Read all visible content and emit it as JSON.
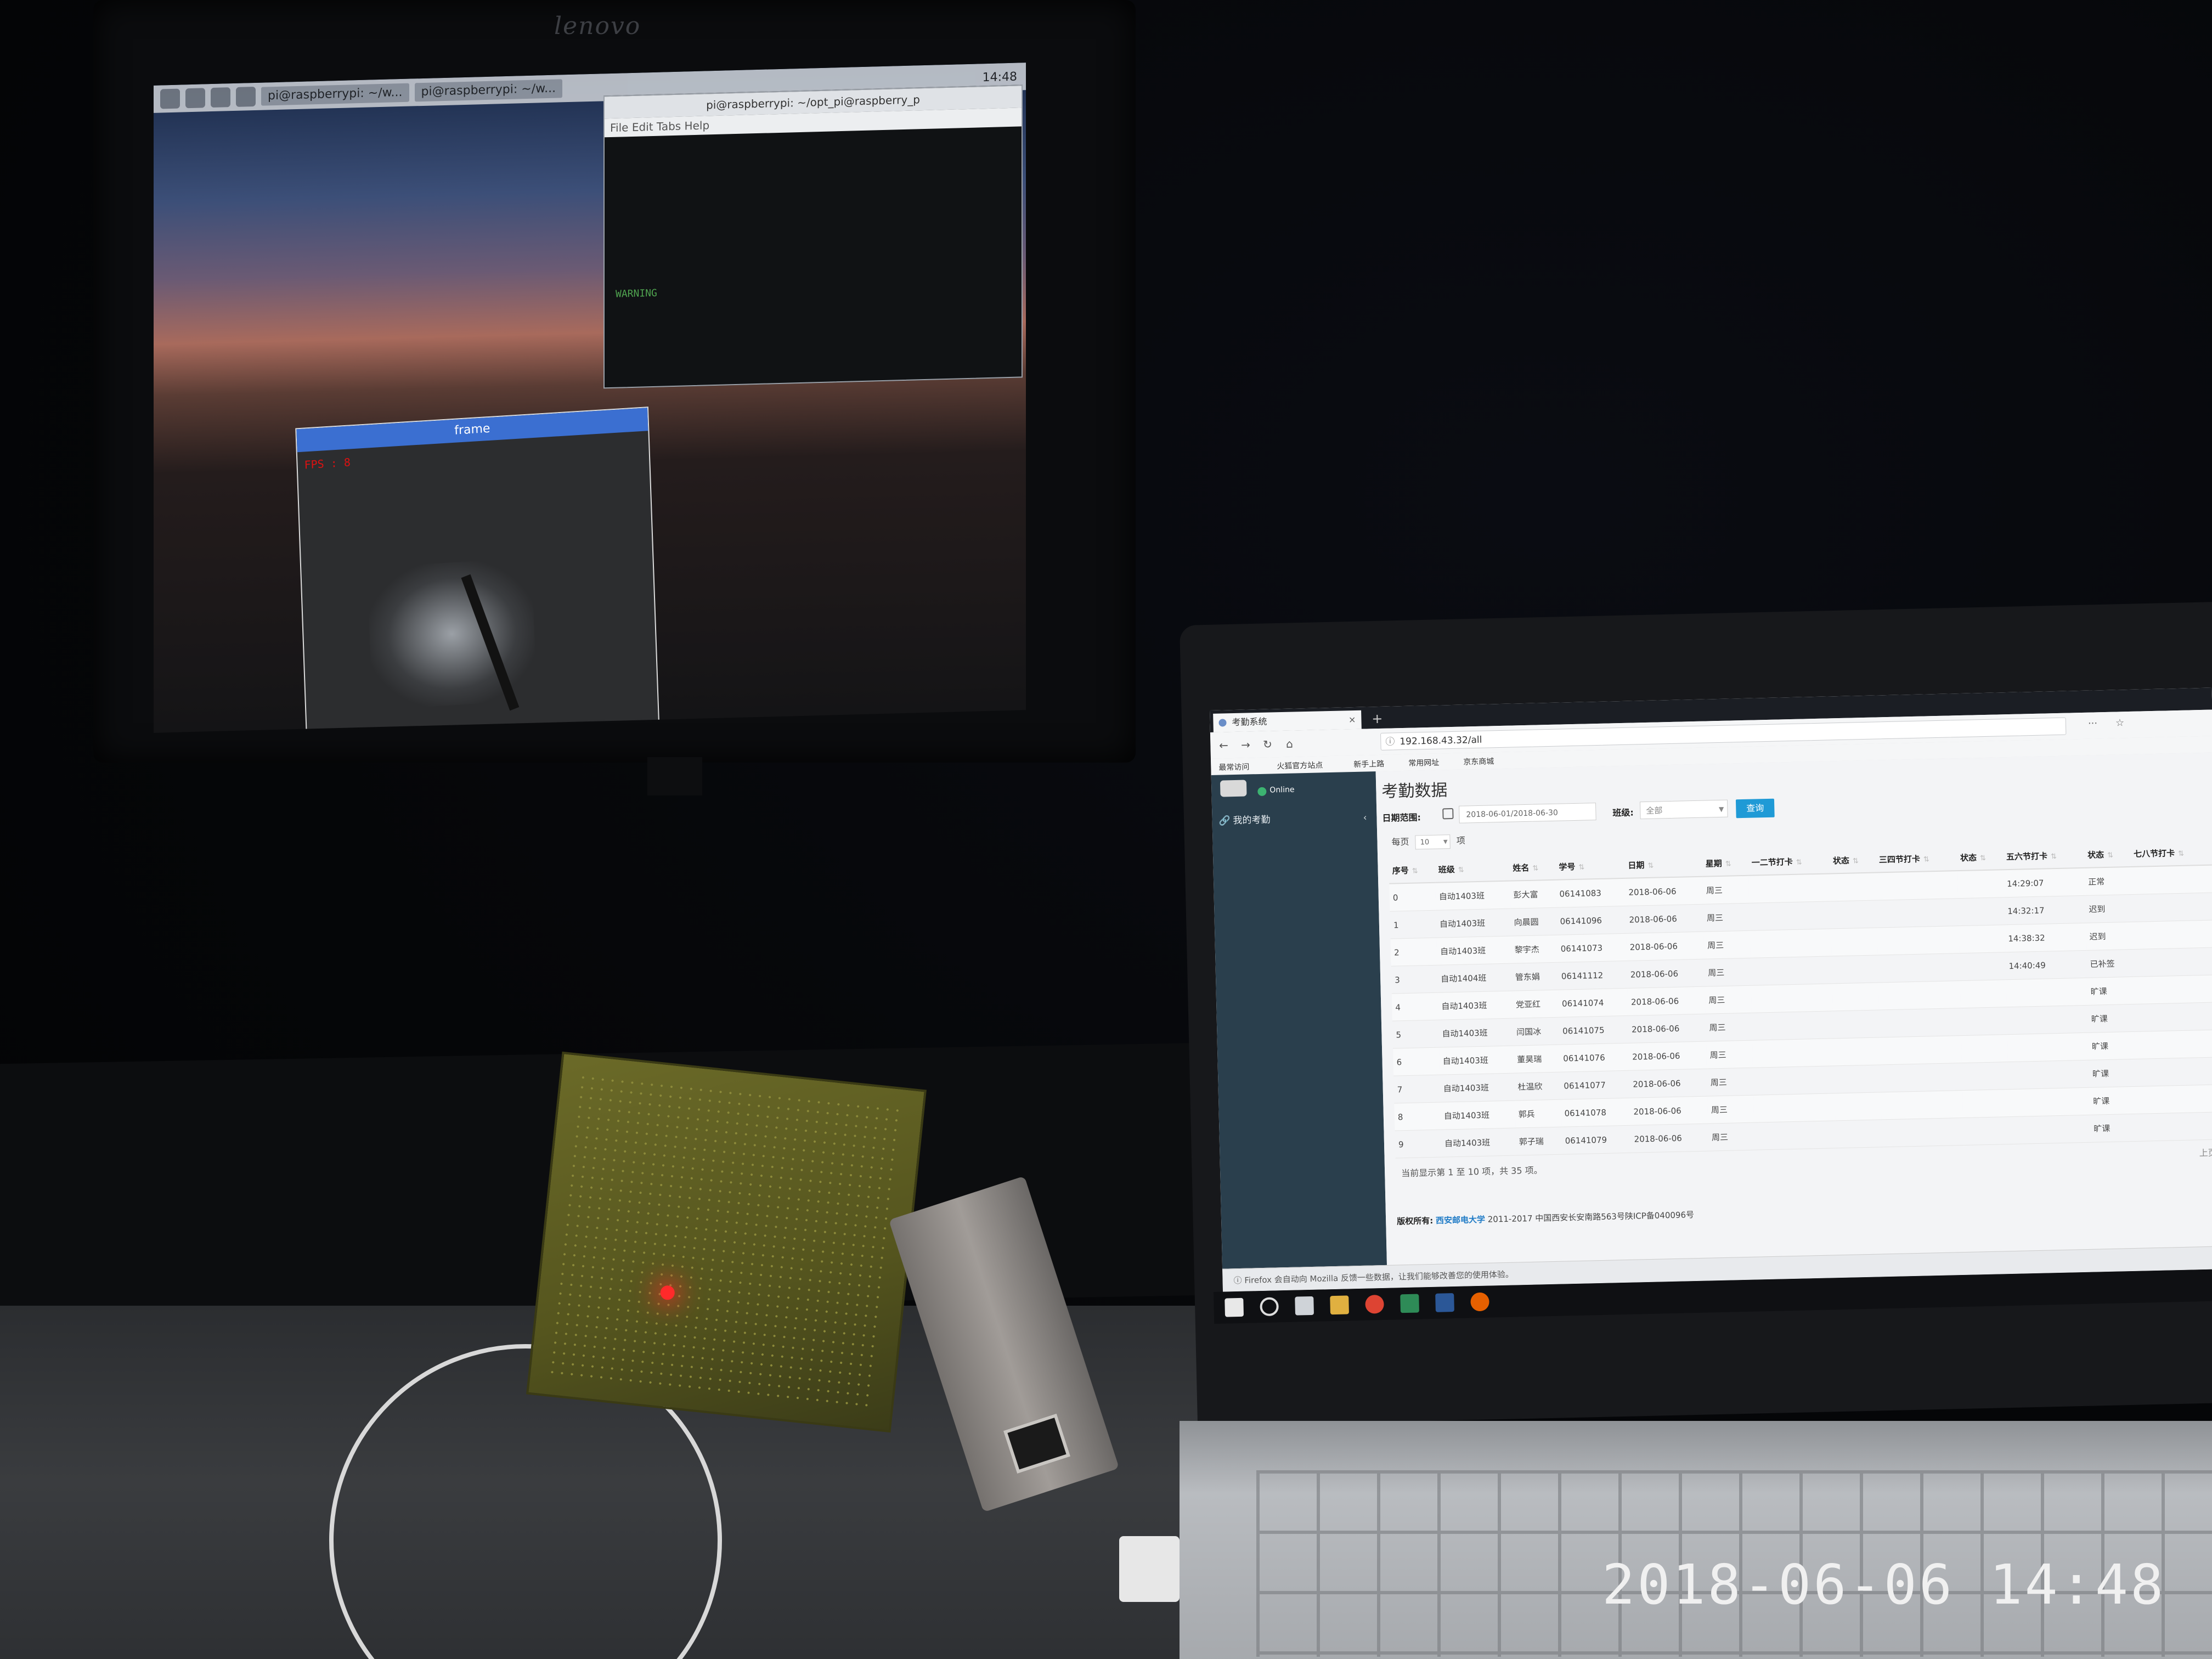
{
  "left_monitor": {
    "brand": "lenovo",
    "taskbar_tasks": [
      "pi@raspberrypi: ~/w...",
      "pi@raspberrypi: ~/w..."
    ],
    "clock": "14:48",
    "terminal": {
      "title": "pi@raspberrypi: ~/opt_pi@raspberry_p",
      "menu": "File  Edit  Tabs  Help",
      "warning": "WARNING"
    },
    "frame_window": {
      "title": "frame",
      "fps": "FPS : 8"
    }
  },
  "browser": {
    "tab_title": "考勤系统",
    "tab_close": "×",
    "new_tab": "+",
    "url": "192.168.43.32/all",
    "bookmarks": [
      "最常访问",
      "火狐官方站点",
      "新手上路",
      "常用网址",
      "京东商城"
    ],
    "nav": {
      "back": "←",
      "forward": "→",
      "reload": "↻",
      "home": "⌂",
      "more": "···",
      "star": "☆"
    }
  },
  "sidebar": {
    "status": "Online",
    "items": [
      {
        "label": "我的考勤"
      }
    ]
  },
  "main": {
    "title": "考勤数据",
    "date_label": "日期范围:",
    "date_value": "2018-06-01/2018-06-30",
    "class_label": "班级:",
    "class_value": "全部",
    "query_button": "查询",
    "per_page_prefix": "每页",
    "per_page_value": "10",
    "per_page_suffix": "项",
    "columns": [
      "序号",
      "班级",
      "姓名",
      "学号",
      "日期",
      "星期",
      "一二节打卡",
      "状态",
      "三四节打卡",
      "状态",
      "五六节打卡",
      "状态",
      "七八节打卡"
    ],
    "rows": [
      [
        "0",
        "自动1403班",
        "彭大富",
        "06141083",
        "2018-06-06",
        "周三",
        "",
        "",
        "",
        "",
        "14:29:07",
        "正常",
        ""
      ],
      [
        "1",
        "自动1403班",
        "向晨圆",
        "06141096",
        "2018-06-06",
        "周三",
        "",
        "",
        "",
        "",
        "14:32:17",
        "迟到",
        ""
      ],
      [
        "2",
        "自动1403班",
        "黎宇杰",
        "06141073",
        "2018-06-06",
        "周三",
        "",
        "",
        "",
        "",
        "14:38:32",
        "迟到",
        ""
      ],
      [
        "3",
        "自动1404班",
        "管东娟",
        "06141112",
        "2018-06-06",
        "周三",
        "",
        "",
        "",
        "",
        "14:40:49",
        "已补签",
        ""
      ],
      [
        "4",
        "自动1403班",
        "党亚红",
        "06141074",
        "2018-06-06",
        "周三",
        "",
        "",
        "",
        "",
        "",
        "旷课",
        ""
      ],
      [
        "5",
        "自动1403班",
        "闫国冰",
        "06141075",
        "2018-06-06",
        "周三",
        "",
        "",
        "",
        "",
        "",
        "旷课",
        ""
      ],
      [
        "6",
        "自动1403班",
        "董昊瑞",
        "06141076",
        "2018-06-06",
        "周三",
        "",
        "",
        "",
        "",
        "",
        "旷课",
        ""
      ],
      [
        "7",
        "自动1403班",
        "杜温欣",
        "06141077",
        "2018-06-06",
        "周三",
        "",
        "",
        "",
        "",
        "",
        "旷课",
        ""
      ],
      [
        "8",
        "自动1403班",
        "郭兵",
        "06141078",
        "2018-06-06",
        "周三",
        "",
        "",
        "",
        "",
        "",
        "旷课",
        ""
      ],
      [
        "9",
        "自动1403班",
        "郭子瑞",
        "06141079",
        "2018-06-06",
        "周三",
        "",
        "",
        "",
        "",
        "",
        "旷课",
        ""
      ]
    ],
    "table_info": "当前显示第 1 至 10 项，共 35 项。",
    "prev": "上页",
    "footer_label": "版权所有:",
    "footer_school": "西安邮电大学",
    "footer_rest": "2011-2017 中国西安长安南路563号陕ICP备040096号"
  },
  "notification": "Firefox 会自动向 Mozilla 反馈一些数据，让我们能够改善您的使用体验。",
  "timestamp": "2018-06-06 14:48",
  "colors": {
    "sidebar": "#2a3f4d",
    "query_button": "#1f9ad6",
    "status_red": "#e23b3b",
    "online": "#3cb371"
  }
}
